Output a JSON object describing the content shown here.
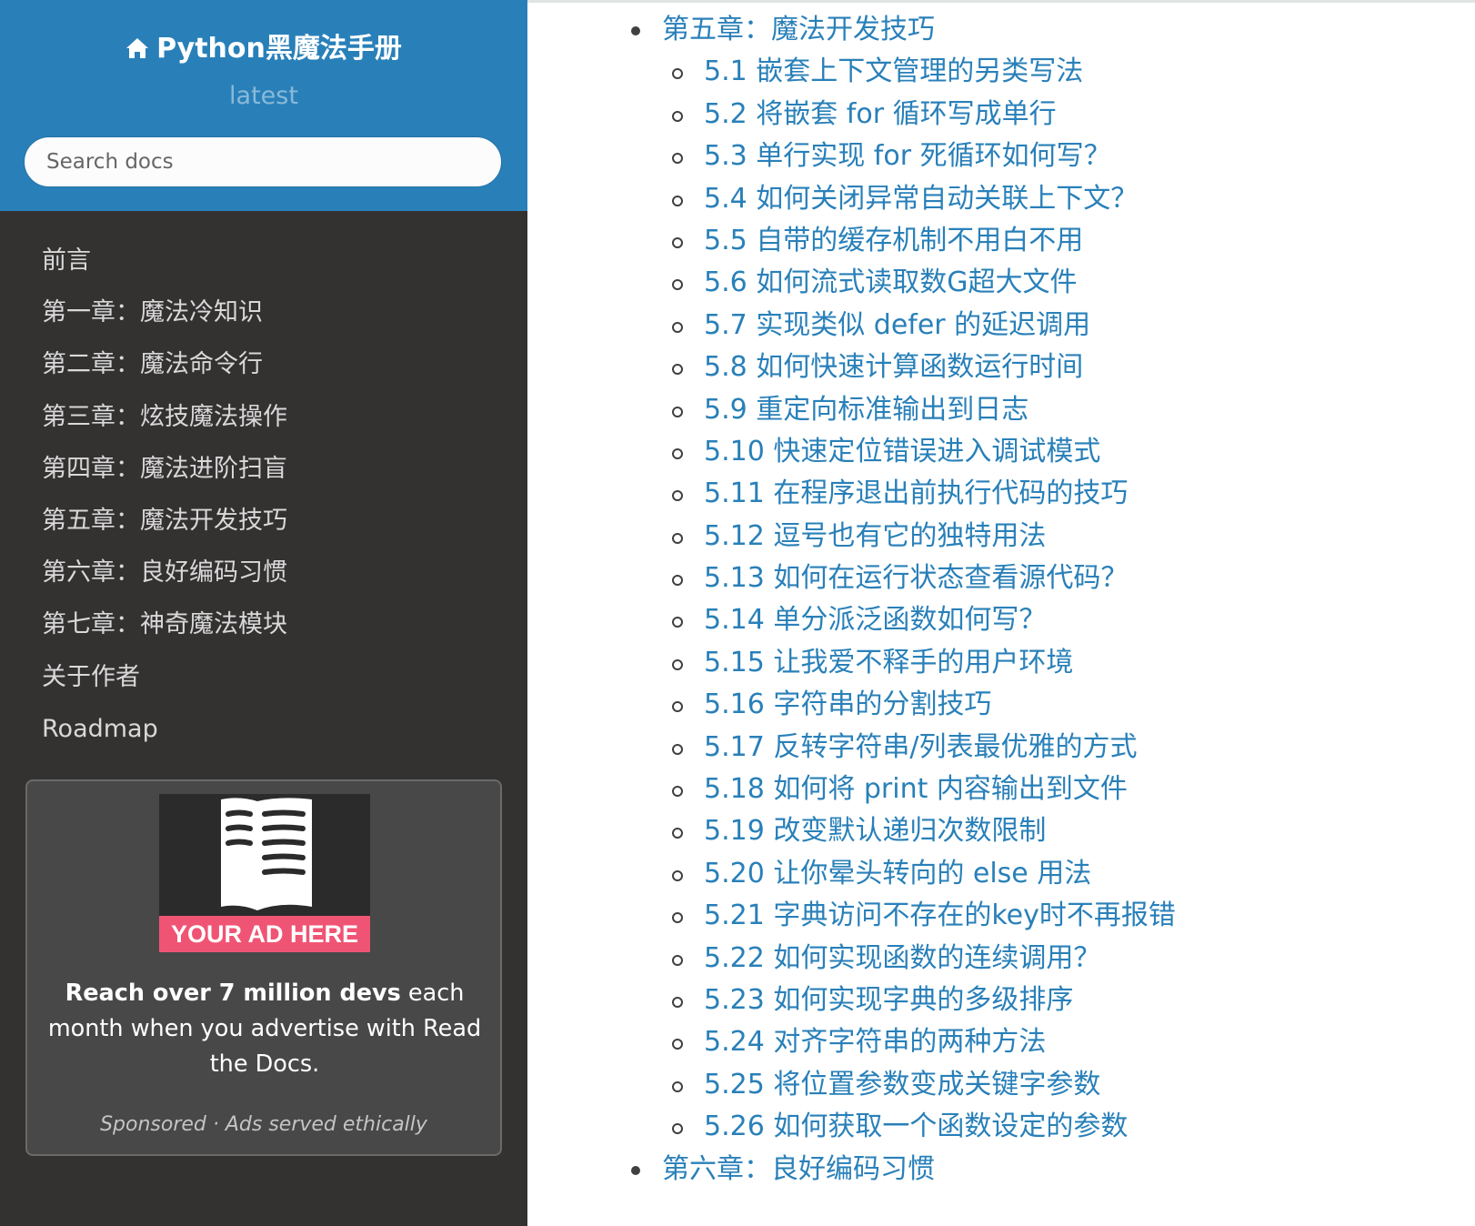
{
  "sidebar": {
    "project_title": "Python黑魔法手册",
    "version": "latest",
    "search": {
      "placeholder": "Search docs"
    },
    "nav": [
      "前言",
      "第一章：魔法冷知识",
      "第二章：魔法命令行",
      "第三章：炫技魔法操作",
      "第四章：魔法进阶扫盲",
      "第五章：魔法开发技巧",
      "第六章：良好编码习惯",
      "第七章：神奇魔法模块",
      "关于作者",
      "Roadmap"
    ],
    "ad": {
      "banner": "YOUR AD HERE",
      "text_bold": "Reach over 7 million devs",
      "text_rest": " each month when you advertise with Read the Docs.",
      "footer_sponsored": "Sponsored",
      "footer_separator": " · ",
      "footer_ethical": "Ads served ethically"
    }
  },
  "toc": {
    "chapter5": "第五章：魔法开发技巧",
    "sections": [
      "5.1 嵌套上下文管理的另类写法",
      "5.2 将嵌套 for 循环写成单行",
      "5.3 单行实现 for 死循环如何写？",
      "5.4 如何关闭异常自动关联上下文？",
      "5.5 自带的缓存机制不用白不用",
      "5.6 如何流式读取数G超大文件",
      "5.7 实现类似 defer 的延迟调用",
      "5.8 如何快速计算函数运行时间",
      "5.9 重定向标准输出到日志",
      "5.10 快速定位错误进入调试模式",
      "5.11 在程序退出前执行代码的技巧",
      "5.12 逗号也有它的独特用法",
      "5.13 如何在运行状态查看源代码？",
      "5.14 单分派泛函数如何写？",
      "5.15 让我爱不释手的用户环境",
      "5.16 字符串的分割技巧",
      "5.17 反转字符串/列表最优雅的方式",
      "5.18 如何将 print 内容输出到文件",
      "5.19 改变默认递归次数限制",
      "5.20 让你晕头转向的 else 用法",
      "5.21 字典访问不存在的key时不再报错",
      "5.22 如何实现函数的连续调用？",
      "5.23 如何实现字典的多级排序",
      "5.24 对齐字符串的两种方法",
      "5.25 将位置参数变成关键字参数",
      "5.26 如何获取一个函数设定的参数"
    ],
    "chapter6": "第六章：良好编码习惯"
  },
  "colors": {
    "sidebar_bg": "#343131",
    "header_bg": "#2980b9",
    "link": "#2980b9",
    "ad_banner": "#f05474"
  }
}
